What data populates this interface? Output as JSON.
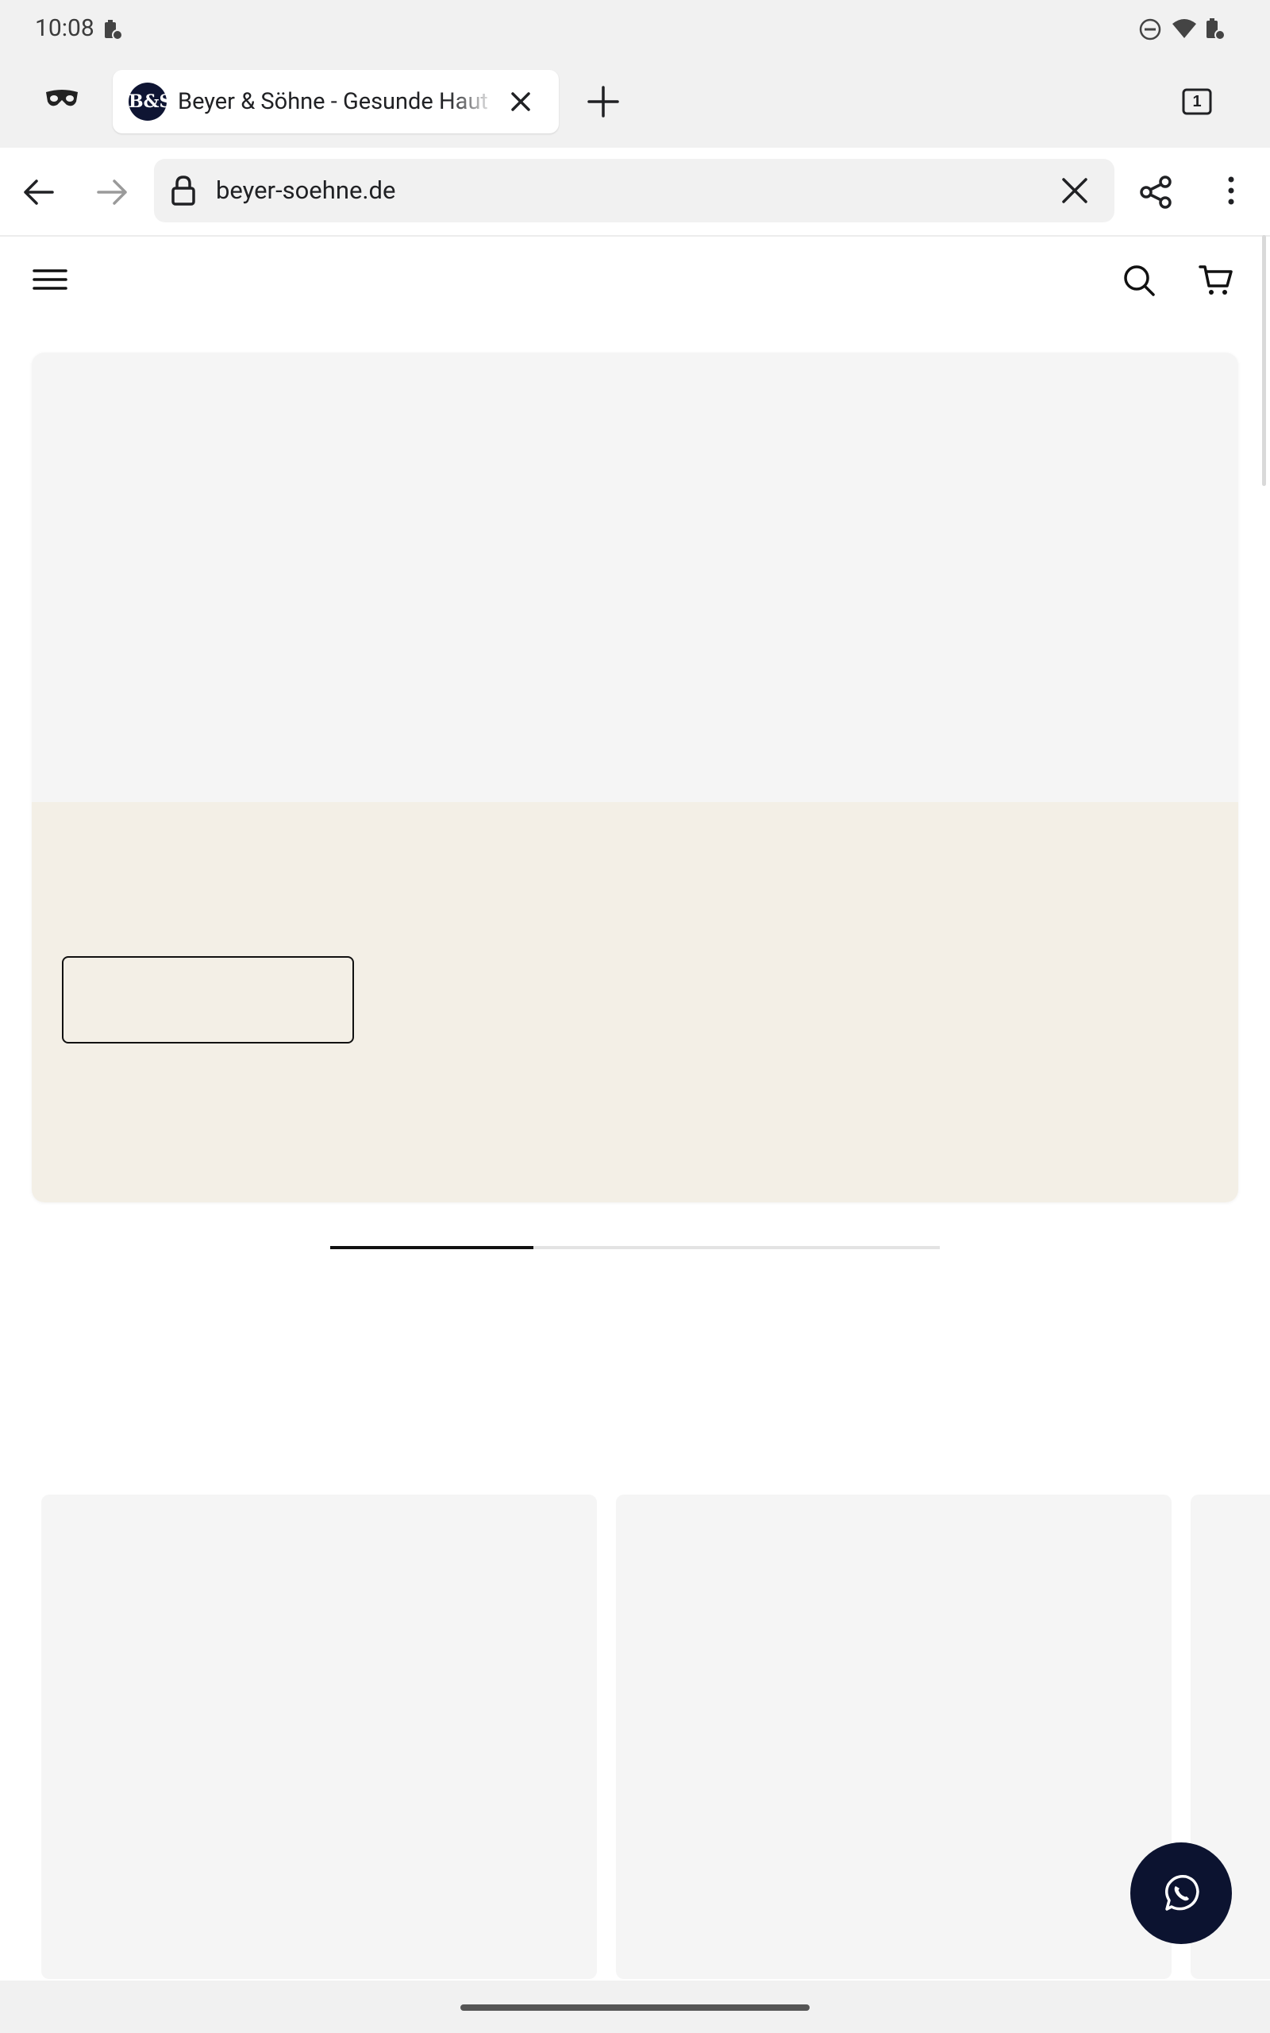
{
  "status_bar": {
    "time": "10:08",
    "icons": [
      "battery-saver-icon",
      "do-not-disturb-icon",
      "wifi-icon",
      "battery-icon"
    ]
  },
  "browser": {
    "incognito_icon": "incognito-mask-icon",
    "tab": {
      "favicon_text": "B&S",
      "title": "Beyer & Söhne - Gesunde Haut"
    },
    "tab_count": "1",
    "url": "beyer-soehne.de",
    "toolbar_icons": [
      "back-arrow-icon",
      "forward-arrow-icon",
      "lock-icon",
      "clear-icon",
      "share-icon",
      "more-vert-icon"
    ]
  },
  "site": {
    "header_icons": [
      "hamburger-menu-icon",
      "search-icon",
      "cart-icon"
    ],
    "hero": {
      "image_color": "#f5f5f5",
      "content_bg_color": "#f3efe6",
      "button_label": ""
    },
    "carousel": {
      "progress": 0.333
    },
    "products": [
      {
        "name": ""
      },
      {
        "name": ""
      },
      {
        "name": ""
      }
    ],
    "chat_button_icon": "whatsapp-icon"
  },
  "colors": {
    "brand_dark": "#0c1330",
    "chrome_bg": "#f1f1f1"
  }
}
